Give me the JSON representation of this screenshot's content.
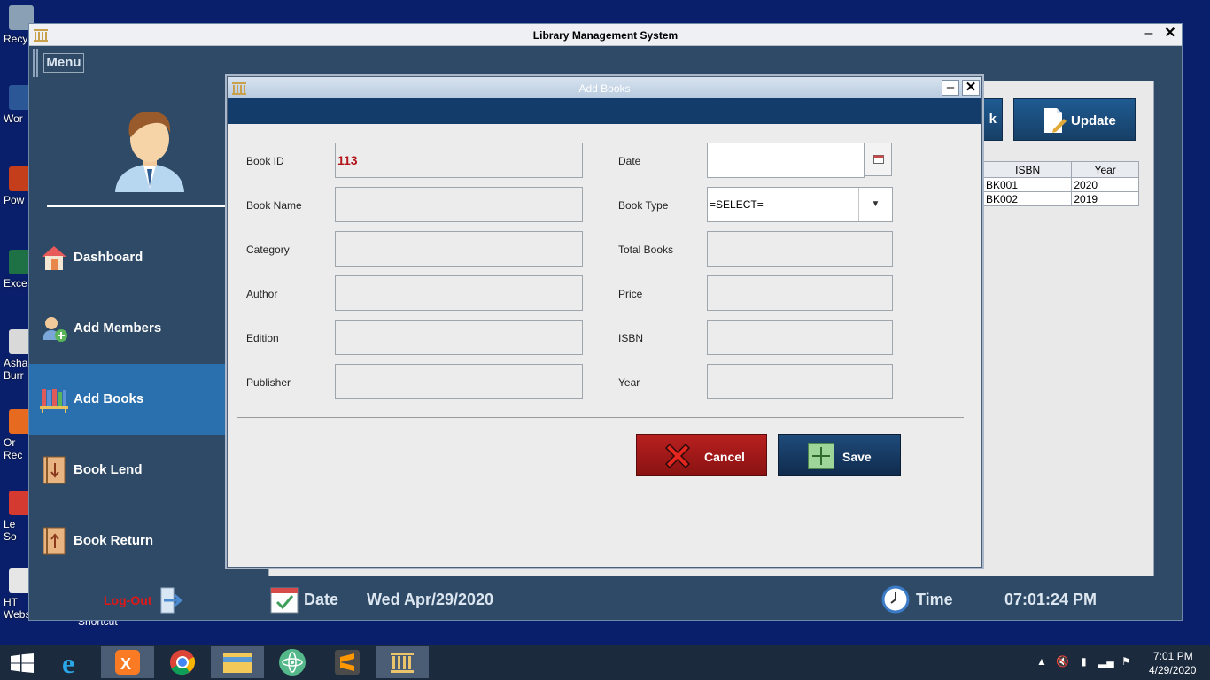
{
  "desktop": {
    "icons": [
      {
        "label": "Recy",
        "icon": "recycle-bin-icon"
      },
      {
        "label": "Wor",
        "icon": "word-icon"
      },
      {
        "label": "Pow",
        "icon": "powerpoint-icon"
      },
      {
        "label": "Exce",
        "icon": "excel-icon"
      },
      {
        "label": "Asha",
        "sublabel": "Burr",
        "icon": "shortcut-icon"
      },
      {
        "label": "Or",
        "sublabel": "Rec",
        "icon": "shortcut-icon"
      },
      {
        "label": "Le",
        "sublabel": "So",
        "icon": "shortcut-icon"
      },
      {
        "label": "HT",
        "sublabel": "Websit...",
        "icon": "html-icon"
      }
    ],
    "shortcut_text": "Shortcut"
  },
  "main_window": {
    "title": "Library Management System",
    "menu_label": "Menu",
    "sidebar": {
      "items": [
        {
          "label": "Dashboard",
          "icon": "home-icon"
        },
        {
          "label": "Add Members",
          "icon": "add-member-icon"
        },
        {
          "label": "Add Books",
          "icon": "books-icon",
          "active": true
        },
        {
          "label": "Book Lend",
          "icon": "book-lend-icon"
        },
        {
          "label": "Book Return",
          "icon": "book-return-icon"
        }
      ],
      "logout_label": "Log-Out"
    },
    "status": {
      "date_label": "Date",
      "date_value": "Wed Apr/29/2020",
      "time_label": "Time",
      "time_value": "07:01:24 PM"
    },
    "background_panel": {
      "partial_button_label": "k",
      "update_label": "Update",
      "table": {
        "columns": [
          "ISBN",
          "Year"
        ],
        "rows": [
          [
            "BK001",
            "2020"
          ],
          [
            "BK002",
            "2019"
          ]
        ]
      }
    }
  },
  "dialog": {
    "title": "Add Books",
    "left_fields": [
      {
        "label": "Book ID",
        "value": "113"
      },
      {
        "label": "Book Name",
        "value": ""
      },
      {
        "label": "Category",
        "value": ""
      },
      {
        "label": "Author",
        "value": ""
      },
      {
        "label": "Edition",
        "value": ""
      },
      {
        "label": "Publisher",
        "value": ""
      }
    ],
    "right_fields": [
      {
        "label": "Date",
        "value": ""
      },
      {
        "label": "Book Type",
        "value": "=SELECT="
      },
      {
        "label": "Total Books",
        "value": ""
      },
      {
        "label": "Price",
        "value": ""
      },
      {
        "label": "ISBN",
        "value": ""
      },
      {
        "label": "Year",
        "value": ""
      }
    ],
    "cancel_label": "Cancel",
    "save_label": "Save"
  },
  "taskbar": {
    "apps": [
      "ie-icon",
      "xampp-icon",
      "chrome-icon",
      "file-explorer-icon",
      "atom-icon",
      "sublime-icon",
      "library-app-icon"
    ],
    "time": "7:01 PM",
    "date": "4/29/2020"
  },
  "colors": {
    "desktop": "#0a1f6b",
    "sidebar": "#2f4a66",
    "active_nav": "#2a6fae",
    "dialog_band": "#133c6a",
    "cancel": "#b8201f",
    "save": "#1f4b7a",
    "book_id": "#b3141a",
    "logout": "#e01818"
  }
}
